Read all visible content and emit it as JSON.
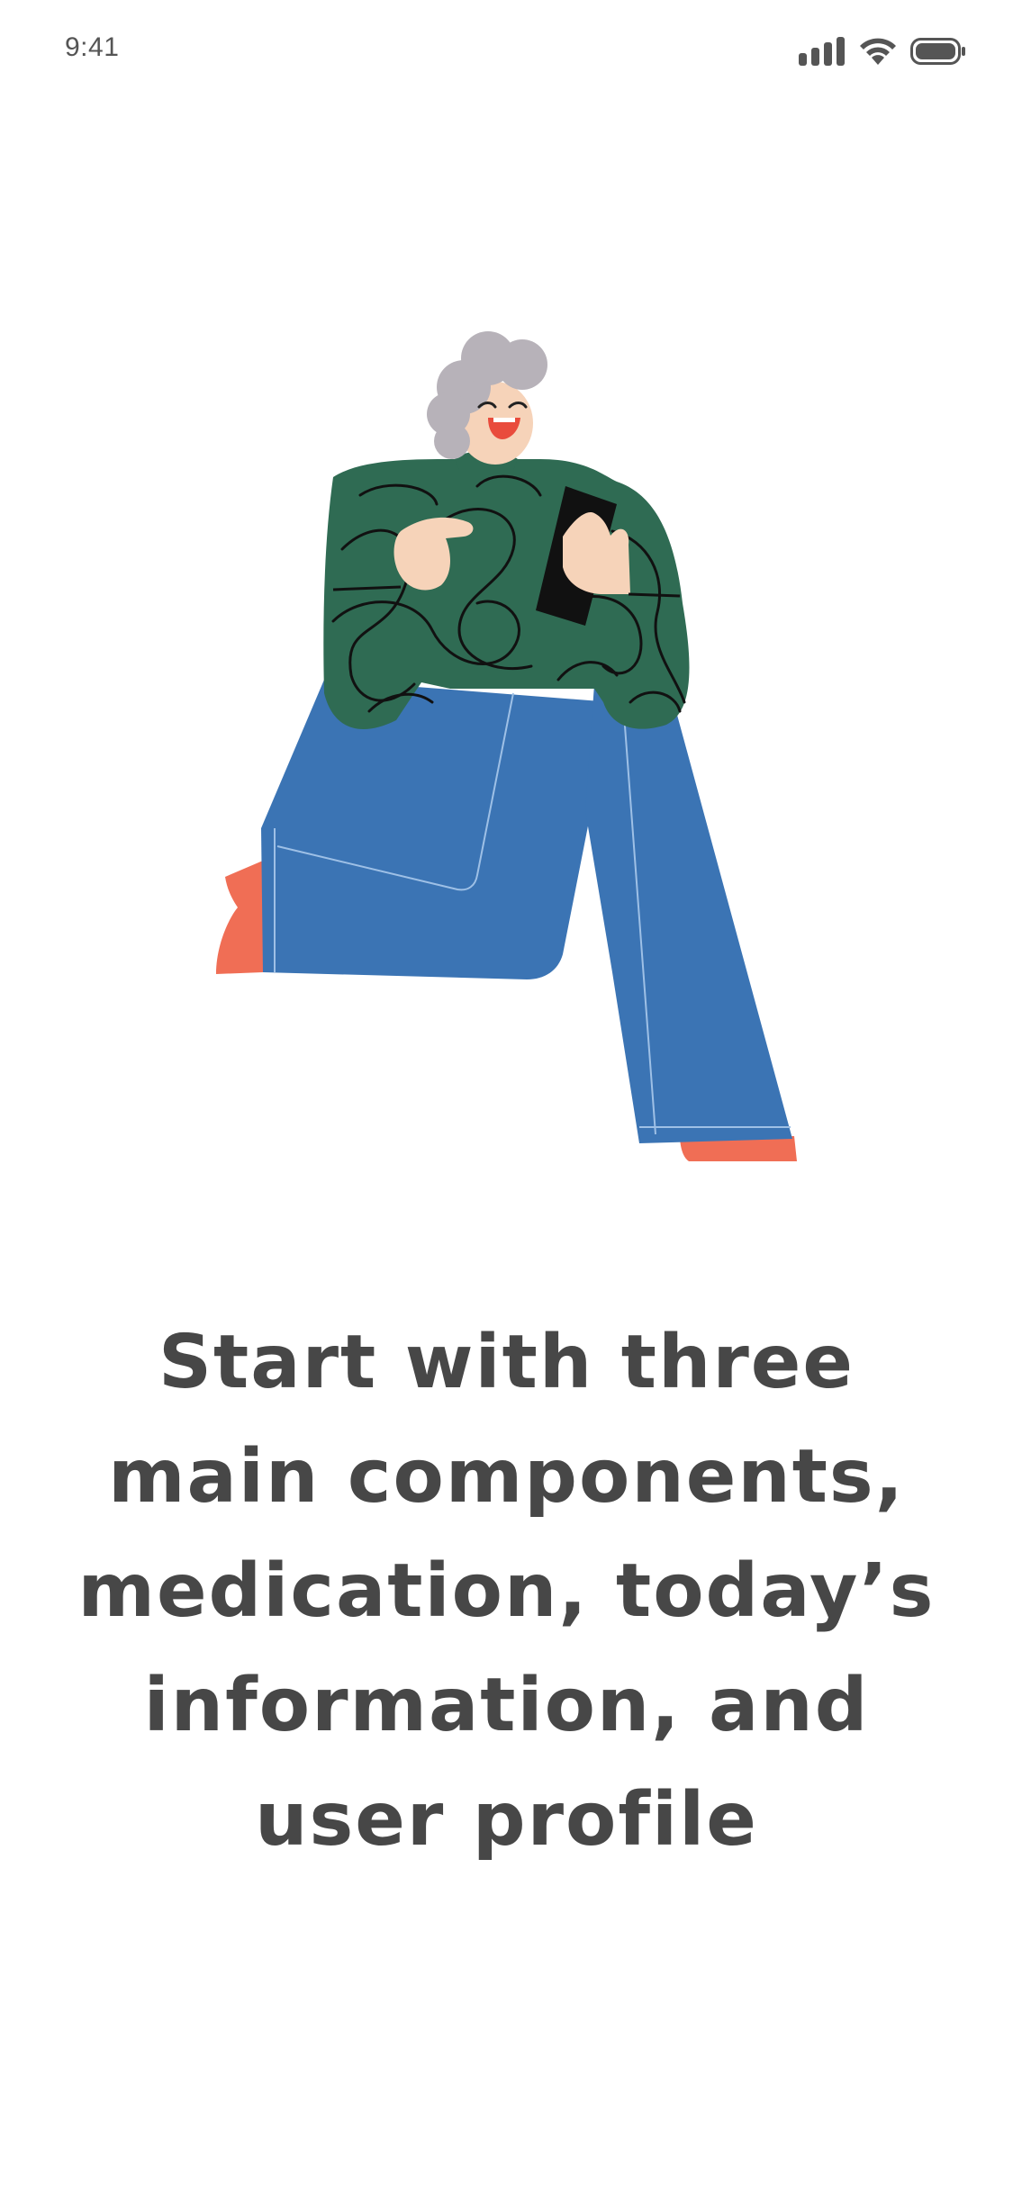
{
  "status_bar": {
    "time": "9:41",
    "icons": [
      "cellular-signal-icon",
      "wifi-icon",
      "battery-icon"
    ]
  },
  "illustration": {
    "subject": "woman-with-phone-illustration"
  },
  "onboarding": {
    "headline_lines": [
      "Start with three",
      "main components,",
      "medication, today’s",
      "information, and",
      "user profile"
    ]
  },
  "colors": {
    "text": "#474747",
    "sweater": "#2f6b53",
    "jeans": "#3b74b4",
    "shoes": "#f06e55",
    "hair": "#b7b2b9",
    "skin": "#f6d3b9"
  }
}
